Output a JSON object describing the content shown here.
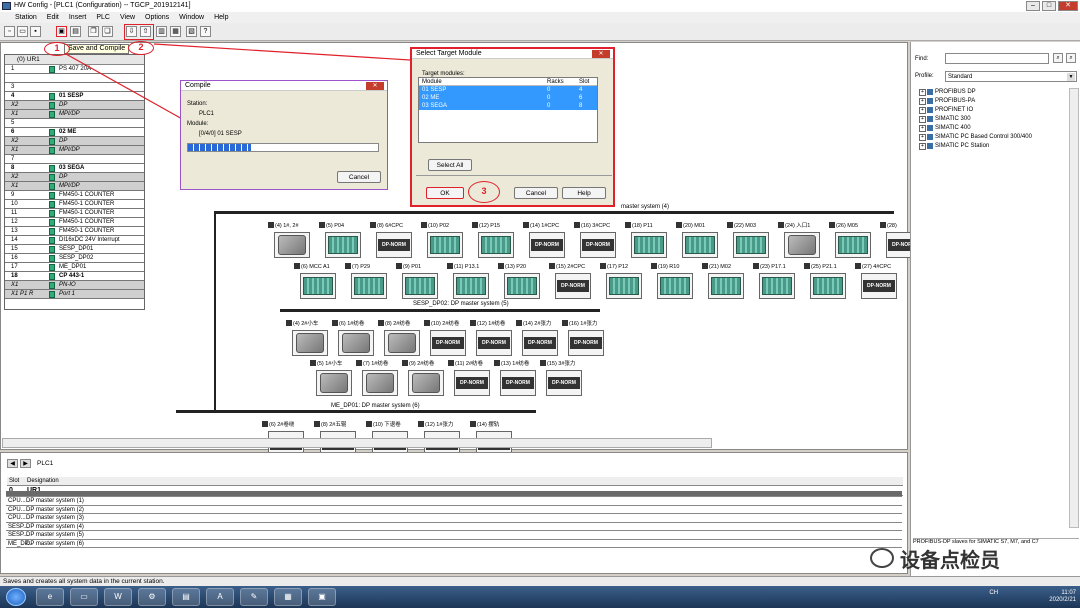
{
  "window": {
    "title": "HW Config - [PLC1 (Configuration) -- TGCP_201912141]"
  },
  "menu": [
    "Station",
    "Edit",
    "Insert",
    "PLC",
    "View",
    "Options",
    "Window",
    "Help"
  ],
  "tooltip": "Save and Compile",
  "markers": [
    "1",
    "2",
    "3"
  ],
  "rack": {
    "title": "(0) UR1",
    "rows": [
      {
        "slot": "1",
        "module": "PS 407 20A",
        "type": "mod"
      },
      {
        "slot": "",
        "module": "",
        "type": "mod"
      },
      {
        "slot": "3",
        "module": "",
        "type": "mod"
      },
      {
        "slot": "4",
        "module": "01 SESP",
        "type": "bold"
      },
      {
        "slot": "X2",
        "module": "DP",
        "type": "sub"
      },
      {
        "slot": "X1",
        "module": "MPI/DP",
        "type": "sub"
      },
      {
        "slot": "5",
        "module": "",
        "type": "mod"
      },
      {
        "slot": "6",
        "module": "02 ME",
        "type": "bold"
      },
      {
        "slot": "X2",
        "module": "DP",
        "type": "sub"
      },
      {
        "slot": "X1",
        "module": "MPI/DP",
        "type": "sub"
      },
      {
        "slot": "7",
        "module": "",
        "type": "mod"
      },
      {
        "slot": "8",
        "module": "03 SEGA",
        "type": "bold"
      },
      {
        "slot": "X2",
        "module": "DP",
        "type": "sub"
      },
      {
        "slot": "X1",
        "module": "MPI/DP",
        "type": "sub"
      },
      {
        "slot": "9",
        "module": "FM450-1 COUNTER",
        "type": "mod"
      },
      {
        "slot": "10",
        "module": "FM450-1 COUNTER",
        "type": "mod"
      },
      {
        "slot": "11",
        "module": "FM450-1 COUNTER",
        "type": "mod"
      },
      {
        "slot": "12",
        "module": "FM450-1 COUNTER",
        "type": "mod"
      },
      {
        "slot": "13",
        "module": "FM450-1 COUNTER",
        "type": "mod"
      },
      {
        "slot": "14",
        "module": "DI16xDC 24V Interrupt",
        "type": "mod"
      },
      {
        "slot": "15",
        "module": "SESP_DP01",
        "type": "mod"
      },
      {
        "slot": "16",
        "module": "SESP_DP02",
        "type": "mod"
      },
      {
        "slot": "17",
        "module": "ME_DP01",
        "type": "mod"
      },
      {
        "slot": "18",
        "module": "CP 443-1",
        "type": "bold"
      },
      {
        "slot": "X1",
        "module": "PN-IO",
        "type": "sub"
      },
      {
        "slot": "X1 P1 R",
        "module": "Port 1",
        "type": "sub"
      }
    ]
  },
  "compile": {
    "title": "Compile",
    "station_label": "Station:",
    "station_value": "PLC1",
    "module_label": "Module:",
    "module_value": "[0/4/0] 01 SESP",
    "progress": 0.33,
    "cancel": "Cancel"
  },
  "select_target": {
    "title": "Select Target Module",
    "group_label": "Target modules:",
    "columns": [
      "Module",
      "Racks",
      "Slot"
    ],
    "rows": [
      {
        "module": "01 SESP",
        "racks": "0",
        "slot": "4"
      },
      {
        "module": "02 ME",
        "racks": "0",
        "slot": "6"
      },
      {
        "module": "03 SEGA",
        "racks": "0",
        "slot": "8"
      }
    ],
    "select_all": "Select All",
    "ok": "OK",
    "cancel": "Cancel",
    "help": "Help"
  },
  "networks": [
    {
      "label": "master system (4)"
    },
    {
      "label": "SESP_DP02: DP master system (5)"
    },
    {
      "label": "ME_DP01: DP master system (6)"
    }
  ],
  "slaves_row1": [
    {
      "tag": "(4) 1#, 2#",
      "kind": "drive"
    },
    {
      "tag": "(5) P04",
      "kind": "rack"
    },
    {
      "tag": "(8) 6#CPC",
      "kind": "dp"
    },
    {
      "tag": "(10) P02",
      "kind": "rack"
    },
    {
      "tag": "(12) P15",
      "kind": "rack"
    },
    {
      "tag": "(14) 1#CPC",
      "kind": "dp"
    },
    {
      "tag": "(16) 3#CPC",
      "kind": "dp"
    },
    {
      "tag": "(18) P11",
      "kind": "rack"
    },
    {
      "tag": "(20) M01",
      "kind": "rack"
    },
    {
      "tag": "(22) M03",
      "kind": "rack"
    },
    {
      "tag": "(24) 入口1",
      "kind": "drive"
    },
    {
      "tag": "(26) M05",
      "kind": "rack"
    },
    {
      "tag": "(28)",
      "kind": "dp"
    }
  ],
  "slaves_row2": [
    {
      "tag": "(6) MCC A1",
      "kind": "rack"
    },
    {
      "tag": "(7) P29",
      "kind": "rack"
    },
    {
      "tag": "(9) P01",
      "kind": "rack"
    },
    {
      "tag": "(11) P13.1",
      "kind": "rack"
    },
    {
      "tag": "(13) P20",
      "kind": "rack"
    },
    {
      "tag": "(15) 2#CPC",
      "kind": "dp"
    },
    {
      "tag": "(17) P12",
      "kind": "rack"
    },
    {
      "tag": "(19) R10",
      "kind": "rack"
    },
    {
      "tag": "(21) M02",
      "kind": "rack"
    },
    {
      "tag": "(23) P17.1",
      "kind": "rack"
    },
    {
      "tag": "(25) P21.1",
      "kind": "rack"
    },
    {
      "tag": "(27) 4#CPC",
      "kind": "dp"
    }
  ],
  "slaves_row3": [
    {
      "tag": "(4) 2#小车",
      "kind": "drive"
    },
    {
      "tag": "(6) 1#纺卷",
      "kind": "drive"
    },
    {
      "tag": "(8) 2#纺卷",
      "kind": "drive"
    },
    {
      "tag": "(10) 2#纺卷",
      "kind": "dp"
    },
    {
      "tag": "(12) 1#纺卷",
      "kind": "dp"
    },
    {
      "tag": "(14) 2#张力",
      "kind": "dp"
    },
    {
      "tag": "(16) 1#张力",
      "kind": "dp"
    }
  ],
  "slaves_row4": [
    {
      "tag": "(5) 1#小车",
      "kind": "drive"
    },
    {
      "tag": "(7) 1#纺卷",
      "kind": "drive"
    },
    {
      "tag": "(9) 2#纺卷",
      "kind": "drive"
    },
    {
      "tag": "(11) 2#纺卷",
      "kind": "dp"
    },
    {
      "tag": "(13) 1#纺卷",
      "kind": "dp"
    },
    {
      "tag": "(15) 3#张力",
      "kind": "dp"
    }
  ],
  "slaves_row5": [
    {
      "tag": "(6) 2#卷绕",
      "kind": "dp"
    },
    {
      "tag": "(8) 2#五辊",
      "kind": "dp"
    },
    {
      "tag": "(10) 下退卷",
      "kind": "dp"
    },
    {
      "tag": "(12) 1#张力",
      "kind": "dp"
    },
    {
      "tag": "(14) 摆轨",
      "kind": "dp"
    }
  ],
  "dpnorm_label": "DP-NORM",
  "catalog": {
    "find_label": "Find:",
    "profile_label": "Profile:",
    "profile_value": "Standard",
    "tree": [
      "PROFIBUS DP",
      "PROFIBUS-PA",
      "PROFINET IO",
      "SIMATIC 300",
      "SIMATIC 400",
      "SIMATIC PC Based Control 300/400",
      "SIMATIC PC Station"
    ],
    "hint": "PROFIBUS-DP slaves for SIMATIC S7, M7, and C7"
  },
  "bottom": {
    "station": "PLC1",
    "columns": [
      "Slot",
      "Designation"
    ],
    "header_row": {
      "slot": "0",
      "designation": "UR1"
    },
    "rows": [
      {
        "slot": "CPU...",
        "designation": "DP master system (1)"
      },
      {
        "slot": "CPU...",
        "designation": "DP master system (2)"
      },
      {
        "slot": "CPU...",
        "designation": "DP master system (3)"
      },
      {
        "slot": "SESP...",
        "designation": "DP master system (4)"
      },
      {
        "slot": "SESP...",
        "designation": "DP master system (5)"
      },
      {
        "slot": "ME_DP...",
        "designation": "DP master system (6)"
      }
    ]
  },
  "status": "Saves and creates all system data in the current station.",
  "watermark": "设备点检员",
  "tray": {
    "lang": "CH",
    "time": "11:07",
    "date": "2020/2/21"
  },
  "colors": {
    "accent": "#3399ff",
    "annotation": "#e0202a",
    "rack_module": "#3a7"
  }
}
